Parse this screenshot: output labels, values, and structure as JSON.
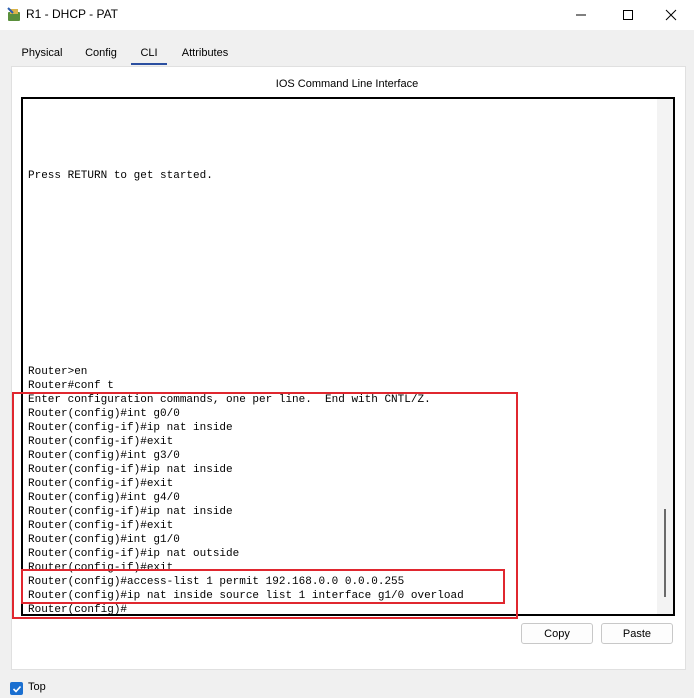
{
  "window": {
    "title": "R1 - DHCP - PAT",
    "icon": "packet-tracer-router-icon",
    "controls": [
      "minimize-icon",
      "maximize-icon",
      "close-icon"
    ]
  },
  "tabs": [
    {
      "label": "Physical",
      "active": false
    },
    {
      "label": "Config",
      "active": false
    },
    {
      "label": "CLI",
      "active": true
    },
    {
      "label": "Attributes",
      "active": false
    }
  ],
  "cli": {
    "heading": "IOS Command Line Interface",
    "lines": [
      "Press RETURN to get started.",
      "Router>en",
      "Router#conf t",
      "Enter configuration commands, one per line.  End with CNTL/Z.",
      "Router(config)#int g0/0",
      "Router(config-if)#ip nat inside",
      "Router(config-if)#exit",
      "Router(config)#int g3/0",
      "Router(config-if)#ip nat inside",
      "Router(config-if)#exit",
      "Router(config)#int g4/0",
      "Router(config-if)#ip nat inside",
      "Router(config-if)#exit",
      "Router(config)#int g1/0",
      "Router(config-if)#ip nat outside",
      "Router(config-if)#exit",
      "Router(config)#access-list 1 permit 192.168.0.0 0.0.0.255",
      "Router(config)#ip nat inside source list 1 interface g1/0 overload",
      "Router(config)#"
    ],
    "highlight_color": "#e0272f"
  },
  "buttons": {
    "copy": "Copy",
    "paste": "Paste"
  },
  "footer": {
    "top_label": "Top",
    "top_checked": true
  }
}
